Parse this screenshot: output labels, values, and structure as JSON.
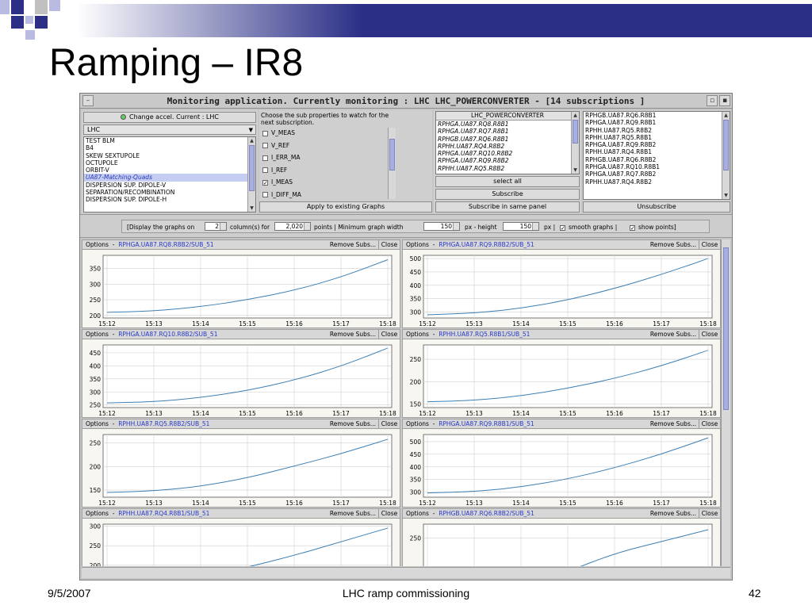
{
  "slide": {
    "title": "Ramping – IR8",
    "footer_date": "9/5/2007",
    "footer_center": "LHC ramp commissioning",
    "footer_page": "42"
  },
  "colors": {
    "navy": "#2b2f86",
    "lavender": "#b9bce0",
    "grey_square": "#c0c0c0",
    "curve": "#3d7fb4",
    "app_bg": "#c6c6c6"
  },
  "app": {
    "window_title": "Monitoring application. Currently monitoring : LHC LHC_POWERCONVERTER - [14 subscriptions ]",
    "accel_button": "Change accel. Current : LHC",
    "accel_select": "LHC",
    "systems": [
      "TEST BLM",
      "B4",
      "SKEW SEXTUPOLE",
      "OCTUPOLE",
      "ORBIT-V",
      "UA87-Matching-Quads",
      "DISPERSION SUP. DIPOLE-V",
      "SEPARATION/RECOMBINATION",
      "DISPERSION SUP. DIPOLE-H"
    ],
    "selected_system": "UA87-Matching-Quads",
    "props_header": "Choose the sub properties to watch for the next subscription.",
    "properties": [
      {
        "label": "V_MEAS",
        "checked": false
      },
      {
        "label": "V_REF",
        "checked": false
      },
      {
        "label": "I_ERR_MA",
        "checked": false
      },
      {
        "label": "I_REF",
        "checked": false
      },
      {
        "label": "I_MEAS",
        "checked": true
      },
      {
        "label": "I_DIFF_MA",
        "checked": false
      }
    ],
    "apply_button": "Apply to existing Graphs",
    "converter_header": "LHC_POWERCONVERTER",
    "converters": [
      "RPHGA.UA87.RQ8.R8B1",
      "RPHGA.UA87.RQ7.R8B1",
      "RPHGB.UA87.RQ6.R8B1",
      "RPHH.UA87.RQ4.R8B2",
      "RPHGA.UA87.RQ10.R8B2",
      "RPHGA.UA87.RQ9.R8B2",
      "RPHH.UA87.RQ5.R8B2"
    ],
    "select_all": "select all",
    "subscribe": "Subscribe",
    "subscribe_same": "Subscribe in same panel",
    "unsubscribe": "Unsubscribe",
    "subscriptions": [
      "RPHGB.UA87.RQ6.R8B1",
      "RPHGA.UA87.RQ9.R8B1",
      "RPHH.UA87.RQ5.R8B2",
      "RPHH.UA87.RQ5.R8B1",
      "RPHGA.UA87.RQ9.R8B2",
      "RPHH.UA87.RQ4.R8B1",
      "RPHGB.UA87.RQ6.R8B2",
      "RPHGA.UA87.RQ10.R8B1",
      "RPHGA.UA87.RQ7.R8B2",
      "RPHH.UA87.RQ4.R8B2"
    ],
    "options": {
      "display_pre": "[Display the graphs on",
      "columns": "2",
      "columns_post": "column(s) for",
      "points": "2,020",
      "points_post": "points | Minimum graph width",
      "width": "150",
      "height_pre": "px - height",
      "height": "150",
      "height_post": "px |",
      "smooth_label": "smooth graphs |",
      "smooth_checked": true,
      "points_label": "show points]",
      "points_checked": true
    },
    "panel_options": "Options",
    "remove_subs": "Remove Subs...",
    "close": "Close"
  },
  "chart_data": [
    {
      "type": "line",
      "series": [
        {
          "name": "RPHGA.UA87.RQ8.R8B2/SUB_51",
          "x": [
            "15:12",
            "15:13",
            "15:14",
            "15:15",
            "15:16",
            "15:17",
            "15:18"
          ],
          "y": [
            210,
            214,
            228,
            250,
            280,
            322,
            378
          ]
        }
      ],
      "yticks": [
        200,
        250,
        300,
        350
      ],
      "ylim": [
        192,
        392
      ]
    },
    {
      "type": "line",
      "series": [
        {
          "name": "RPHGA.UA87.RQ9.R8B2/SUB_51",
          "x": [
            "15:12",
            "15:13",
            "15:14",
            "15:15",
            "15:16",
            "15:17",
            "15:18"
          ],
          "y": [
            290,
            296,
            314,
            345,
            388,
            440,
            500
          ]
        }
      ],
      "yticks": [
        300,
        350,
        400,
        450,
        500
      ],
      "ylim": [
        278,
        512
      ]
    },
    {
      "type": "line",
      "series": [
        {
          "name": "RPHGA.UA87.RQ10.R8B2/SUB_51",
          "x": [
            "15:12",
            "15:13",
            "15:14",
            "15:15",
            "15:16",
            "15:17",
            "15:18"
          ],
          "y": [
            258,
            262,
            278,
            305,
            345,
            398,
            468
          ]
        }
      ],
      "yticks": [
        250,
        300,
        350,
        400,
        450
      ],
      "ylim": [
        240,
        480
      ]
    },
    {
      "type": "line",
      "series": [
        {
          "name": "RPHH.UA87.RQ5.R8B1/SUB_51",
          "x": [
            "15:12",
            "15:13",
            "15:14",
            "15:15",
            "15:16",
            "15:17",
            "15:18"
          ],
          "y": [
            155,
            158,
            168,
            185,
            207,
            235,
            270
          ]
        }
      ],
      "yticks": [
        150,
        200,
        250
      ],
      "ylim": [
        142,
        282
      ]
    },
    {
      "type": "line",
      "series": [
        {
          "name": "RPHH.UA87.RQ5.R8B2/SUB_51",
          "x": [
            "15:12",
            "15:13",
            "15:14",
            "15:15",
            "15:16",
            "15:17",
            "15:18"
          ],
          "y": [
            145,
            148,
            158,
            176,
            201,
            227,
            258
          ]
        }
      ],
      "yticks": [
        150,
        200,
        250
      ],
      "ylim": [
        135,
        268
      ]
    },
    {
      "type": "line",
      "series": [
        {
          "name": "RPHGA.UA87.RQ9.R8B1/SUB_51",
          "x": [
            "15:12",
            "15:13",
            "15:14",
            "15:15",
            "15:16",
            "15:17",
            "15:18"
          ],
          "y": [
            297,
            302,
            320,
            352,
            396,
            450,
            515
          ]
        }
      ],
      "yticks": [
        300,
        350,
        400,
        450,
        500
      ],
      "ylim": [
        280,
        528
      ]
    },
    {
      "type": "line",
      "series": [
        {
          "name": "RPHH.UA87.RQ4.R8B1/SUB_51",
          "x": [
            "15:12",
            "15:13",
            "15:14",
            "15:15",
            "15:16",
            "15:17",
            "15:18"
          ],
          "y": [
            150,
            155,
            170,
            195,
            225,
            260,
            295
          ]
        }
      ],
      "yticks": [
        200,
        250,
        300
      ],
      "ylim": [
        145,
        305
      ]
    },
    {
      "type": "line",
      "series": [
        {
          "name": "RPHGB.UA87.RQ6.R8B2/SUB_51",
          "x": [
            "15:12",
            "15:13",
            "15:14",
            "15:15",
            "15:16",
            "15:17",
            "15:18"
          ],
          "y": [
            160,
            165,
            180,
            202,
            228,
            245,
            262
          ]
        }
      ],
      "yticks": [
        200,
        250
      ],
      "ylim": [
        180,
        270
      ]
    }
  ]
}
